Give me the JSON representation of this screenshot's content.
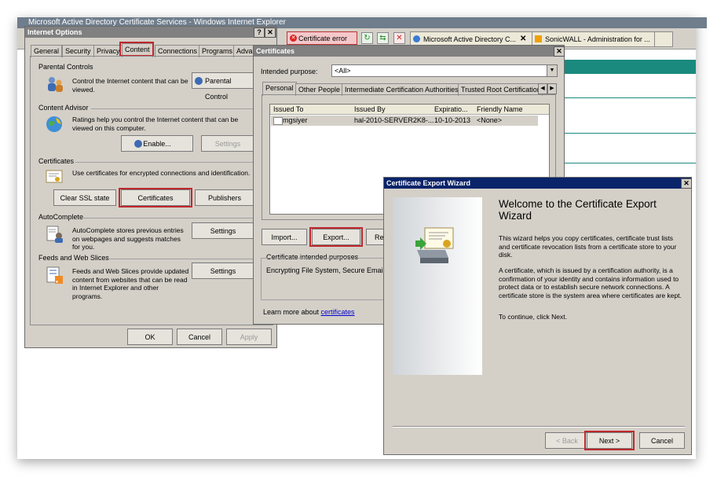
{
  "ie": {
    "title": "Microsoft Active Directory Certificate Services - Windows Internet Explorer",
    "cert_error": "Certificate error",
    "tabs": [
      "Microsoft Active Directory C...",
      "SonicWALL - Administration for ..."
    ]
  },
  "internet_options": {
    "title": "Internet Options",
    "tabs": [
      "General",
      "Security",
      "Privacy",
      "Content",
      "Connections",
      "Programs",
      "Advan"
    ],
    "parental": {
      "heading": "Parental Controls",
      "text": "Control the Internet content that can be viewed.",
      "button": "Parental Control"
    },
    "advisor": {
      "heading": "Content Advisor",
      "text": "Ratings help you control the Internet content that can be viewed on this computer.",
      "enable": "Enable...",
      "settings": "Settings"
    },
    "certificates": {
      "heading": "Certificates",
      "text": "Use certificates for encrypted connections and identification.",
      "clear_ssl": "Clear SSL state",
      "certificates_btn": "Certificates",
      "publishers": "Publishers"
    },
    "autocomplete": {
      "heading": "AutoComplete",
      "text": "AutoComplete stores previous entries on webpages and suggests matches for you.",
      "settings": "Settings"
    },
    "feeds": {
      "heading": "Feeds and Web Slices",
      "text": "Feeds and Web Slices provide updated content from websites that can be read in Internet Explorer and other programs.",
      "settings": "Settings"
    },
    "ok": "OK",
    "cancel": "Cancel",
    "apply": "Apply"
  },
  "certificates_dialog": {
    "title": "Certificates",
    "purpose_label": "Intended purpose:",
    "purpose_value": "<All>",
    "tabs": [
      "Personal",
      "Other People",
      "Intermediate Certification Authorities",
      "Trusted Root Certification"
    ],
    "columns": [
      "Issued To",
      "Issued By",
      "Expiratio...",
      "Friendly Name"
    ],
    "rows": [
      {
        "issued_to": "mgsiyer",
        "issued_by": "hal-2010-SERVER2K8-...",
        "expiration": "10-10-2013",
        "friendly": "<None>"
      }
    ],
    "import": "Import...",
    "export": "Export...",
    "remove": "Rem",
    "purposes_label": "Certificate intended purposes",
    "purposes_value": "Encrypting File System, Secure Email, Cl",
    "learn_prefix": "Learn more about ",
    "learn_link": "certificates"
  },
  "wizard": {
    "title": "Certificate Export Wizard",
    "heading": "Welcome to the Certificate Export Wizard",
    "p1": "This wizard helps you copy certificates, certificate trust lists and certificate revocation lists from a certificate store to your disk.",
    "p2": "A certificate, which is issued by a certification authority, is a confirmation of your identity and contains information used to protect data or to establish secure network connections. A certificate store is the system area where certificates are kept.",
    "p3": "To continue, click Next.",
    "back": "< Back",
    "next": "Next >",
    "cancel": "Cancel"
  },
  "colors": {
    "highlight": "#c0272d",
    "title_active": "#0a246a",
    "title_inactive": "#808080",
    "link": "#0000cc"
  }
}
